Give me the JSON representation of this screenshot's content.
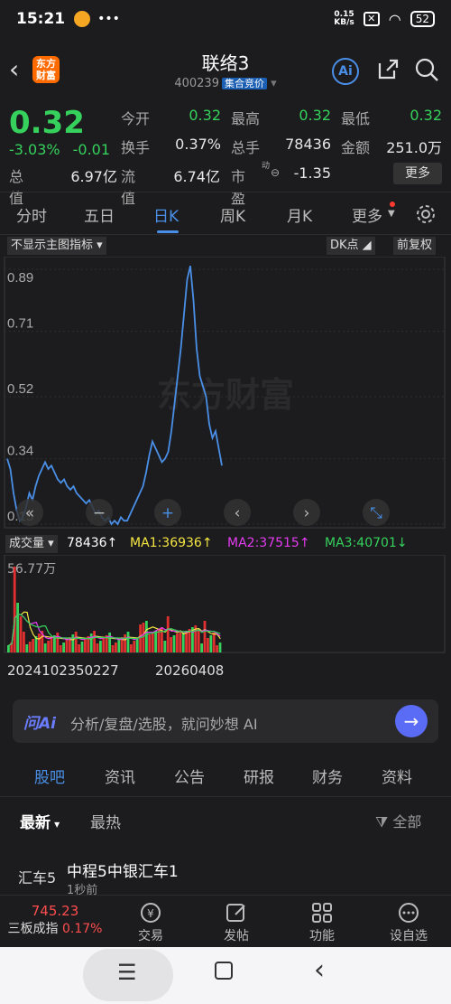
{
  "statusbar": {
    "time": "15:21",
    "netspeed_value": "0.15",
    "netspeed_unit": "KB/s",
    "battery": "52"
  },
  "header": {
    "name": "联络3",
    "code": "400239",
    "tag": "集合竞价",
    "logo_line1": "东方",
    "logo_line2": "财富",
    "ai_label": "Ai"
  },
  "quote": {
    "price": "0.32",
    "change_pct": "-3.03%",
    "change": "-0.01",
    "rows": [
      [
        {
          "label": "今开",
          "value": "0.32",
          "color": "#35d15c"
        },
        {
          "label": "最高",
          "value": "0.32",
          "color": "#35d15c"
        },
        {
          "label": "最低",
          "value": "0.32",
          "color": "#35d15c"
        }
      ],
      [
        {
          "label": "换手",
          "value": "0.37%",
          "color": "#e6e6e6"
        },
        {
          "label": "总手",
          "value": "78436",
          "color": "#e6e6e6"
        },
        {
          "label": "金额",
          "value": "251.0万",
          "color": "#e6e6e6"
        }
      ]
    ],
    "total_label": "总值",
    "total_value": "6.97亿",
    "float_label": "流值",
    "float_value": "6.74亿",
    "pe_label": "市盈",
    "pe_sup": "动",
    "pe_value": "-1.35",
    "more": "更多"
  },
  "tabs": [
    "分时",
    "五日",
    "日K",
    "周K",
    "月K",
    "更多"
  ],
  "active_tab": "日K",
  "chart_toolbar": {
    "indicator": "不显示主图指标",
    "dk": "DK点",
    "adjust": "前复权"
  },
  "chart_data": {
    "type": "line",
    "y_ticks": [
      "0.89",
      "0.71",
      "0.52",
      "0.34",
      "0.15"
    ],
    "ylim": [
      0.15,
      0.89
    ],
    "x_labels": [
      "20241023",
      "20250227",
      "20260408"
    ],
    "x_label_shown": [
      "20241023",
      "50227",
      "20260408"
    ],
    "values": [
      0.34,
      0.31,
      0.24,
      0.19,
      0.16,
      0.17,
      0.2,
      0.24,
      0.22,
      0.26,
      0.29,
      0.31,
      0.33,
      0.31,
      0.32,
      0.3,
      0.28,
      0.27,
      0.28,
      0.26,
      0.25,
      0.26,
      0.24,
      0.23,
      0.22,
      0.21,
      0.22,
      0.2,
      0.18,
      0.19,
      0.17,
      0.16,
      0.17,
      0.15,
      0.16,
      0.15,
      0.17,
      0.16,
      0.16,
      0.18,
      0.2,
      0.22,
      0.24,
      0.26,
      0.3,
      0.35,
      0.39,
      0.37,
      0.35,
      0.33,
      0.34,
      0.36,
      0.42,
      0.5,
      0.58,
      0.66,
      0.76,
      0.86,
      0.9,
      0.8,
      0.66,
      0.58,
      0.55,
      0.52,
      0.44,
      0.4,
      0.42,
      0.37,
      0.32
    ],
    "volume_max_label": "56.77万"
  },
  "vol_bar": {
    "label": "成交量",
    "value": "78436",
    "ma1": "MA1:36936",
    "ma2": "MA2:37515",
    "ma3": "MA3:40701"
  },
  "ai_bar": {
    "logo": "问Ai",
    "placeholder": "分析/复盘/选股，就问妙想 AI"
  },
  "bottom_tabs": [
    "股吧",
    "资讯",
    "公告",
    "研报",
    "财务",
    "资料"
  ],
  "filter": {
    "latest": "最新",
    "hot": "最热",
    "all": "全部"
  },
  "post": {
    "avatar_text": "汇车5",
    "title": "中程5中银汇车1",
    "time": "1秒前"
  },
  "dock": {
    "index_value": "745.23",
    "index_name": "三板成指",
    "index_pct": "0.17%",
    "items": [
      "交易",
      "发帖",
      "功能",
      "设自选"
    ]
  }
}
